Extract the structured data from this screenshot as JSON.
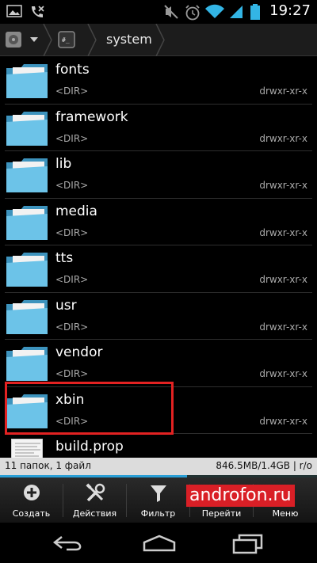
{
  "status_bar": {
    "clock": "19:27",
    "icons": [
      "gallery-icon",
      "phone-missed-icon",
      "mute-icon",
      "alarm-icon",
      "wifi-icon",
      "signal-icon",
      "battery-icon"
    ]
  },
  "breadcrumb": {
    "current": "system"
  },
  "files": [
    {
      "name": "fonts",
      "type": "<DIR>",
      "perm": "drwxr-xr-x",
      "kind": "folder"
    },
    {
      "name": "framework",
      "type": "<DIR>",
      "perm": "drwxr-xr-x",
      "kind": "folder"
    },
    {
      "name": "lib",
      "type": "<DIR>",
      "perm": "drwxr-xr-x",
      "kind": "folder"
    },
    {
      "name": "media",
      "type": "<DIR>",
      "perm": "drwxr-xr-x",
      "kind": "folder"
    },
    {
      "name": "tts",
      "type": "<DIR>",
      "perm": "drwxr-xr-x",
      "kind": "folder"
    },
    {
      "name": "usr",
      "type": "<DIR>",
      "perm": "drwxr-xr-x",
      "kind": "folder"
    },
    {
      "name": "vendor",
      "type": "<DIR>",
      "perm": "drwxr-xr-x",
      "kind": "folder"
    },
    {
      "name": "xbin",
      "type": "<DIR>",
      "perm": "drwxr-xr-x",
      "kind": "folder"
    },
    {
      "name": "build.prop",
      "type": "",
      "perm": "",
      "kind": "file"
    }
  ],
  "info": {
    "summary": "11 папок, 1 файл",
    "storage": "846.5MB/1.4GB | r/o",
    "storage_used_fraction": 0.59
  },
  "toolbar": {
    "create": "Создать",
    "actions": "Действия",
    "filter": "Фильтр",
    "goto": "Перейти",
    "menu": "Меню"
  },
  "watermark": "androfon.ru",
  "colors": {
    "folder": "#5fb7dd",
    "highlight": "#e32222",
    "progress": "#2a9fd6"
  }
}
